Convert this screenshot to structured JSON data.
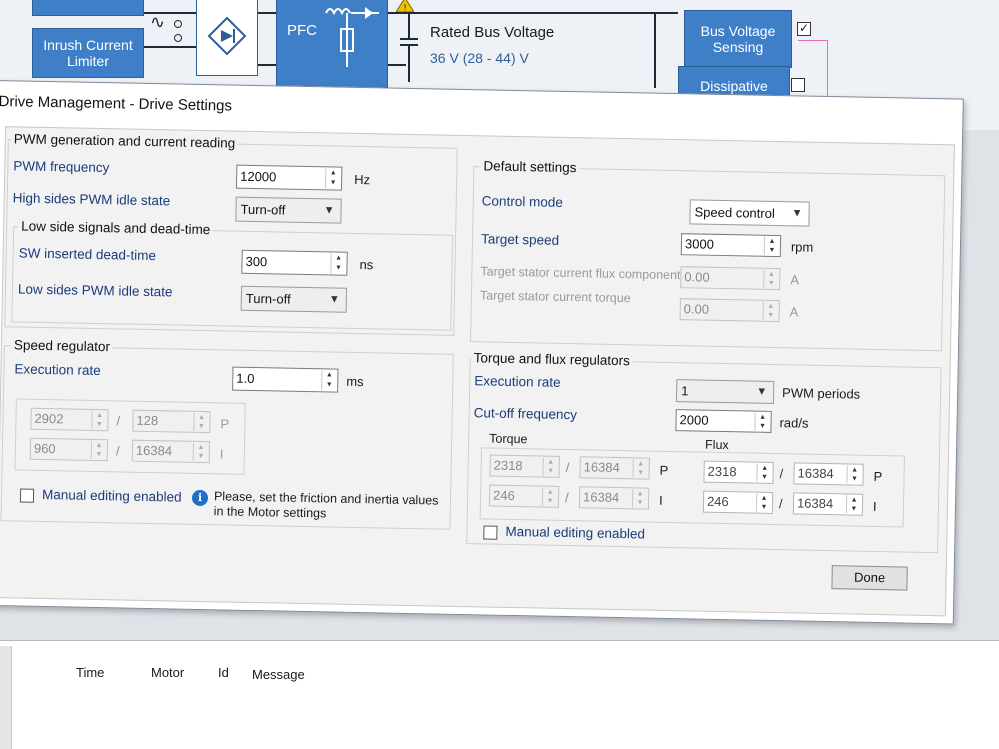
{
  "diagram": {
    "inrush_block": "Inrush Current Limiter",
    "pfc_block": "PFC",
    "bus_voltage_label": "Rated Bus Voltage",
    "bus_voltage_value": "36 V (28 - 44) V",
    "bus_sensing_block": "Bus Voltage Sensing",
    "dissipative_block": "Dissipative Brake",
    "bus_sensing_checked": "✓"
  },
  "dialog": {
    "title": "Drive Management - Drive Settings",
    "pwm_group": {
      "title": "PWM generation and current reading",
      "pwm_frequency_label": "PWM frequency",
      "pwm_frequency_value": "12000",
      "pwm_frequency_unit": "Hz",
      "high_sides_label": "High sides PWM idle state",
      "high_sides_value": "Turn-off",
      "low_side_title": "Low side signals and dead-time",
      "sw_dead_time_label": "SW inserted dead-time",
      "sw_dead_time_value": "300",
      "sw_dead_time_unit": "ns",
      "low_sides_label": "Low sides PWM idle state",
      "low_sides_value": "Turn-off"
    },
    "speed_regulator": {
      "title": "Speed regulator",
      "execution_rate_label": "Execution rate",
      "execution_rate_value": "1.0",
      "execution_rate_unit": "ms",
      "kp_num": "2902",
      "kp_den": "128",
      "ki_num": "960",
      "ki_den": "16384",
      "p_label": "P",
      "i_label": "I",
      "manual_editing_label": "Manual editing enabled",
      "info_text": "Please, set the friction and inertia values in the Motor settings"
    },
    "default_settings": {
      "title": "Default settings",
      "control_mode_label": "Control mode",
      "control_mode_value": "Speed control",
      "target_speed_label": "Target speed",
      "target_speed_value": "3000",
      "target_speed_unit": "rpm",
      "flux_component_label": "Target stator current flux component",
      "flux_component_value": "0.00",
      "flux_component_unit": "A",
      "torque_label": "Target stator current torque",
      "torque_value": "0.00",
      "torque_unit": "A"
    },
    "torque_flux": {
      "title": "Torque and flux regulators",
      "execution_rate_label": "Execution rate",
      "execution_rate_value": "1",
      "execution_rate_unit": "PWM periods",
      "cutoff_label": "Cut-off frequency",
      "cutoff_value": "2000",
      "cutoff_unit": "rad/s",
      "torque_title": "Torque",
      "torque_kp_num": "2318",
      "torque_kp_den": "16384",
      "torque_ki_num": "246",
      "torque_ki_den": "16384",
      "flux_title": "Flux",
      "flux_kp_num": "2318",
      "flux_kp_den": "16384",
      "flux_ki_num": "246",
      "flux_ki_den": "16384",
      "p_label": "P",
      "i_label": "I",
      "manual_editing_label": "Manual editing enabled"
    },
    "done_label": "Done"
  },
  "log": {
    "columns": [
      "Time",
      "Motor",
      "Id",
      "Message"
    ]
  }
}
